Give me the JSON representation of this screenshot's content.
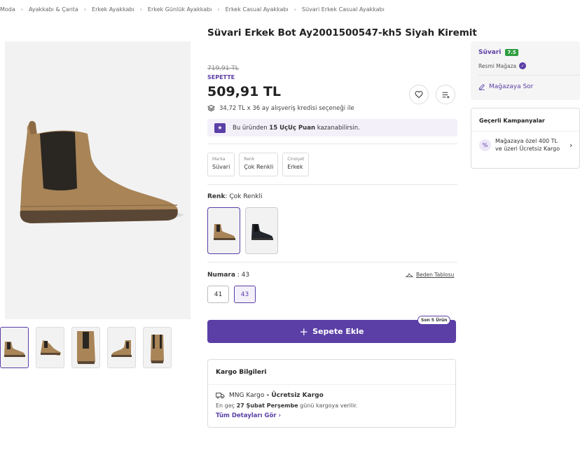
{
  "breadcrumb": [
    "Moda",
    "Ayakkabı & Çanta",
    "Erkek Ayakkabı",
    "Erkek Günlük Ayakkabı",
    "Erkek Casual Ayakkabı",
    "Süvari Erkek Casual Ayakkabı"
  ],
  "product": {
    "title": "Süvari Erkek Bot Ay2001500547-kh5 Siyah Kiremit",
    "old_price": "719,91 TL",
    "sepette": "SEPETTE",
    "price": "509,91 TL",
    "credit_text": "34,72 TL x 36 ay alışveriş kredisi seçeneği ile",
    "points_prefix": "Bu üründen ",
    "points_bold": "15 UçUç Puan",
    "points_suffix": " kazanabilirsin."
  },
  "attributes": [
    {
      "key": "Marka",
      "value": "Süvari"
    },
    {
      "key": "Renk",
      "value": "Çok Renkli"
    },
    {
      "key": "Cinsiyet",
      "value": "Erkek"
    }
  ],
  "color": {
    "label": "Renk",
    "value": "Çok Renkli"
  },
  "size": {
    "label": "Numara",
    "value": "43",
    "table_link": "Beden Tablosu",
    "options": [
      "41",
      "43"
    ],
    "selected": "43"
  },
  "cart": {
    "button_label": "Sepete Ekle",
    "stock_badge": "Son 5 Ürün"
  },
  "cargo": {
    "title": "Kargo Bilgileri",
    "carrier": "MNG Kargo",
    "separator": " - ",
    "shipping": "Ücretsiz Kargo",
    "eta_prefix": "En geç ",
    "eta_date": "27 Şubat Perşembe",
    "eta_suffix": " günü kargoya verilir.",
    "details_link": "Tüm Detayları Gör"
  },
  "seller": {
    "name": "Süvari",
    "rating": "7.5",
    "official": "Resmi Mağaza",
    "ask_label": "Mağazaya Sor"
  },
  "campaigns": {
    "title": "Geçerli Kampanyalar",
    "items": [
      {
        "text": "Mağazaya özel 400 TL ve üzeri Ücretsiz Kargo"
      }
    ]
  },
  "colors": {
    "brand": "#5b3fa6",
    "rating_green": "#2e9e3f"
  }
}
